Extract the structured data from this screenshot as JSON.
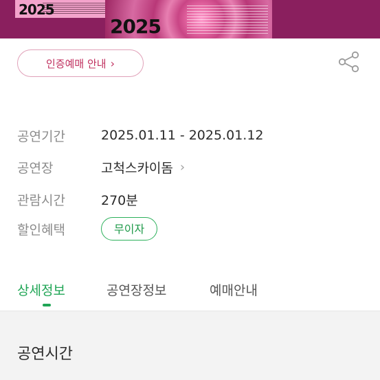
{
  "banner": {
    "year_left": "2025",
    "year_center": "2025"
  },
  "certification_button": {
    "label": "인증예매 안내",
    "chevron": "›"
  },
  "info": {
    "period_label": "공연기간",
    "period_value": "2025.01.11 - 2025.01.12",
    "venue_label": "공연장",
    "venue_value": "고척스카이돔",
    "venue_arrow": "›",
    "duration_label": "관람시간",
    "duration_value": "270분",
    "discount_label": "할인혜택",
    "discount_badge": "무이자"
  },
  "tabs": [
    {
      "label": "상세정보",
      "active": true
    },
    {
      "label": "공연장정보",
      "active": false
    },
    {
      "label": "예매안내",
      "active": false
    }
  ],
  "section": {
    "title": "공연시간"
  },
  "colors": {
    "accent_green": "#1fa555",
    "accent_pink": "#c0305f",
    "banner_bg": "#8a1f5e"
  },
  "icons": {
    "share": "share-icon",
    "chevron": "chevron-right-icon"
  }
}
